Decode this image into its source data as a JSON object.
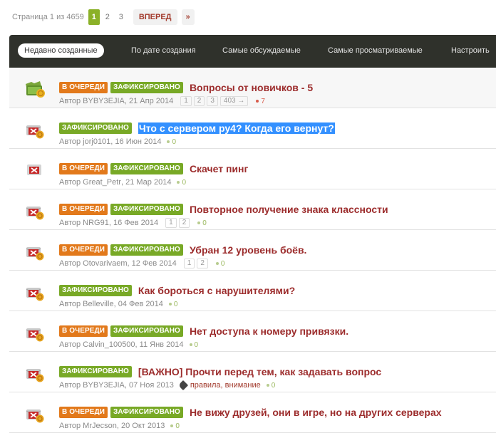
{
  "pagination": {
    "label": "Страница 1 из 4659",
    "pages": [
      "1",
      "2",
      "3"
    ],
    "next_label": "ВПЕРЕД",
    "last_label": "»"
  },
  "tabs": [
    "Недавно созданные",
    "По дате создания",
    "Самые обсуждаемые",
    "Самые просматриваемые",
    "Настроить"
  ],
  "badges": {
    "queue": "В ОЧЕРЕДИ",
    "fixed": "ЗАФИКСИРОВАНО"
  },
  "author_prefix": "Автор",
  "topics": [
    {
      "icon": "folder",
      "queue": true,
      "fixed": true,
      "title": "Вопросы от новичков - 5",
      "author": "BYBY3EJIA",
      "date": "21 Апр 2014",
      "pages": [
        "1",
        "2",
        "3",
        "403 →"
      ],
      "replies": "7",
      "hot": true
    },
    {
      "icon": "locked",
      "queue": false,
      "fixed": true,
      "title": "Что с сервером ру4? Когда его вернут?",
      "selected": true,
      "author": "jorj0101",
      "date": "16 Июн 2014",
      "pages": [],
      "replies": "0"
    },
    {
      "icon": "closed",
      "queue": true,
      "fixed": true,
      "title": "Скачет пинг",
      "author": "Great_Petr",
      "date": "21 Мар 2014",
      "pages": [],
      "replies": "0"
    },
    {
      "icon": "locked",
      "queue": true,
      "fixed": true,
      "title": "Повторное получение знака классности",
      "author": "NRG91",
      "date": "16 Фев 2014",
      "pages": [
        "1",
        "2"
      ],
      "replies": "0"
    },
    {
      "icon": "locked",
      "queue": true,
      "fixed": true,
      "title": "Убран 12 уровень боёв.",
      "author": "Otovarivaem",
      "date": "12 Фев 2014",
      "pages": [
        "1",
        "2"
      ],
      "replies": "0"
    },
    {
      "icon": "locked",
      "queue": false,
      "fixed": true,
      "title": "Как бороться с нарушителями?",
      "author": "Belleville",
      "date": "04 Фев 2014",
      "pages": [],
      "replies": "0"
    },
    {
      "icon": "locked",
      "queue": true,
      "fixed": true,
      "title": "Нет доступа к номеру привязки.",
      "author": "Calvin_100500",
      "date": "11 Янв 2014",
      "pages": [],
      "replies": "0"
    },
    {
      "icon": "locked",
      "queue": false,
      "fixed": true,
      "title": "[ВАЖНО] Прочти перед тем, как задавать вопрос",
      "author": "BYBY3EJIA",
      "date": "07 Ноя 2013",
      "pages": [],
      "tags": "правила, внимание",
      "replies": "0"
    },
    {
      "icon": "locked",
      "queue": true,
      "fixed": true,
      "title": "Не вижу друзей, они в игре, но на других серверах",
      "author": "MrJecson",
      "date": "20 Окт 2013",
      "pages": [],
      "replies": "0"
    }
  ],
  "colors": {
    "accent_red": "#9c2c2c",
    "badge_orange": "#e2791b",
    "badge_green": "#78a926",
    "tabbar": "#2f312b",
    "active_page": "#8bb128"
  }
}
